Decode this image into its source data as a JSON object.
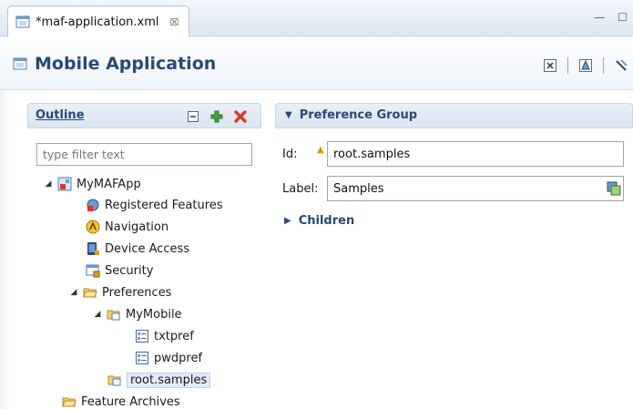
{
  "tab": {
    "title": "*maf-application.xml",
    "close": "☒"
  },
  "window_controls": {
    "minimize": "—",
    "maximize": "☐"
  },
  "editor": {
    "title": "Mobile Application"
  },
  "header_tools": [
    "xml-icon",
    "overview-icon",
    "bindings-icon"
  ],
  "outline": {
    "title": "Outline",
    "filter_placeholder": "type filter text",
    "tree": [
      {
        "label": "MyMAFApp",
        "icon": "maf-app-icon",
        "twisty": "◢"
      },
      {
        "label": "Registered Features",
        "icon": "features-icon"
      },
      {
        "label": "Navigation",
        "icon": "navigation-icon"
      },
      {
        "label": "Device Access",
        "icon": "device-access-icon"
      },
      {
        "label": "Security",
        "icon": "security-icon"
      },
      {
        "label": "Preferences",
        "icon": "folder-icon",
        "twisty": "◢"
      },
      {
        "label": "MyMobile",
        "icon": "pref-group-icon",
        "twisty": "◢"
      },
      {
        "label": "txtpref",
        "icon": "pref-item-icon"
      },
      {
        "label": "pwdpref",
        "icon": "pref-item-icon"
      },
      {
        "label": "root.samples",
        "icon": "pref-group-icon",
        "selected": true
      },
      {
        "label": "Feature Archives",
        "icon": "folder-icon"
      }
    ]
  },
  "preference_group": {
    "title": "Preference Group",
    "id_label": "Id:",
    "id_value": "root.samples",
    "label_label": "Label:",
    "label_value": "Samples",
    "children_label": "Children"
  },
  "colors": {
    "accent": "#284a73",
    "selection": "#e2ebf5",
    "delete": "#d93a2b",
    "add": "#3fa33a"
  }
}
